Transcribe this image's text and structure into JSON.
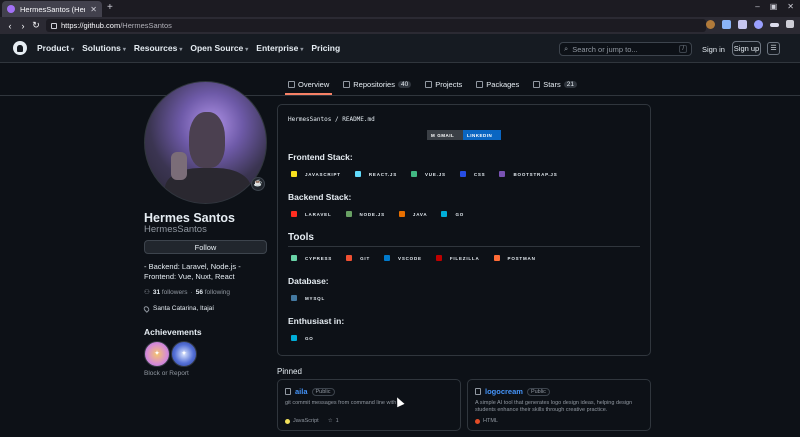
{
  "browser": {
    "tab_title": "HermesSantos (Hermes",
    "url_host": "https://github.com",
    "url_path": "/HermesSantos"
  },
  "header": {
    "menu": [
      {
        "label": "Product",
        "chevron": true
      },
      {
        "label": "Solutions",
        "chevron": true
      },
      {
        "label": "Resources",
        "chevron": true
      },
      {
        "label": "Open Source",
        "chevron": true
      },
      {
        "label": "Enterprise",
        "chevron": true
      },
      {
        "label": "Pricing",
        "chevron": false
      }
    ],
    "search_placeholder": "Search or jump to...",
    "search_shortcut": "/",
    "signin": "Sign in",
    "signup": "Sign up"
  },
  "tabs": [
    {
      "label": "Overview",
      "count": ""
    },
    {
      "label": "Repositories",
      "count": "40"
    },
    {
      "label": "Projects",
      "count": ""
    },
    {
      "label": "Packages",
      "count": ""
    },
    {
      "label": "Stars",
      "count": "21"
    }
  ],
  "profile": {
    "name": "Hermes Santos",
    "login": "HermesSantos",
    "follow_label": "Follow",
    "bio": "- Backend: Laravel, Node.js - Frontend: Vue, Nuxt, React",
    "followers": "31",
    "followers_label": "followers",
    "separator": "·",
    "following": "56",
    "following_label": "following",
    "location": "Santa Catarina, Itajaí",
    "achievements_title": "Achievements",
    "block_report": "Block or Report"
  },
  "readme": {
    "path_user": "HermesSantos",
    "path_sep": "/",
    "path_file": "README.md",
    "shields": [
      "GMAIL",
      "LINKEDIN"
    ],
    "frontend_title": "Frontend Stack:",
    "frontend": [
      "JAVASCRIPT",
      "REACT.JS",
      "VUE.JS",
      "CSS",
      "BOOTSTRAP.JS"
    ],
    "backend_title": "Backend Stack:",
    "backend": [
      "LARAVEL",
      "NODE.JS",
      "JAVA",
      "GO"
    ],
    "tools_title": "Tools",
    "tools": [
      "CYPRESS",
      "GIT",
      "VSCODE",
      "FILEZILLA",
      "POSTMAN"
    ],
    "database_title": "Database:",
    "database": [
      "MYSQL"
    ],
    "enthusiast_title": "Enthusiast in:",
    "enthusiast": [
      "GO"
    ]
  },
  "pinned": {
    "title": "Pinned",
    "repos": [
      {
        "name": "aila",
        "visibility": "Public",
        "description": "git commit messages from command line with",
        "language": "JavaScript",
        "language_color": "#f1e05a",
        "stars": "1"
      },
      {
        "name": "logocream",
        "visibility": "Public",
        "description": "A simple AI tool that generates logo design ideas, helping design students enhance their skills through creative practice.",
        "language": "HTML",
        "language_color": "#e34c26",
        "stars": ""
      }
    ]
  }
}
